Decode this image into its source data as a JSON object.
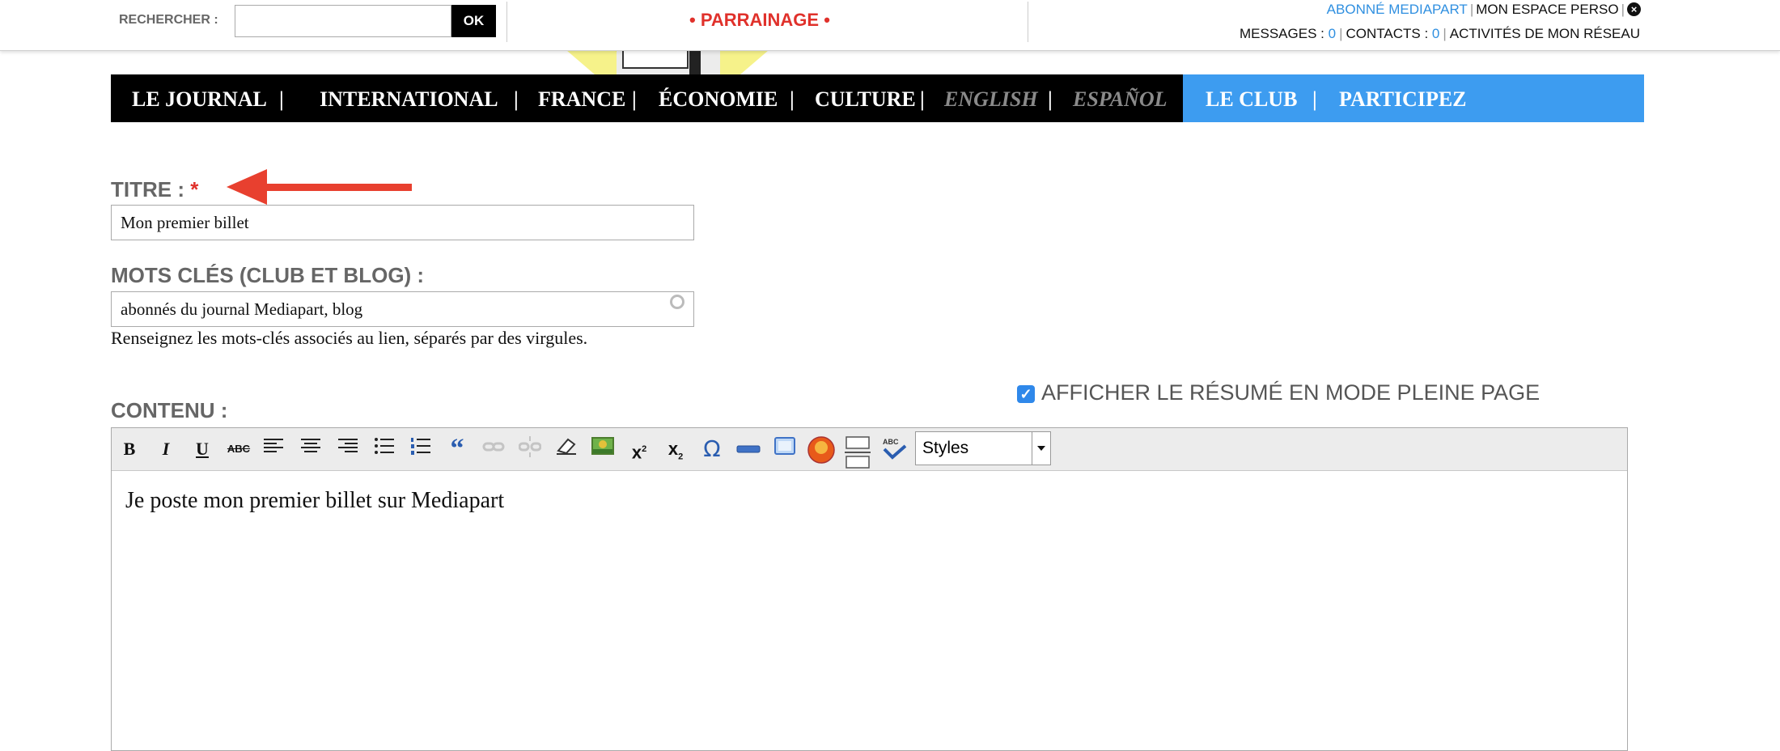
{
  "topbar": {
    "search_label": "RECHERCHER :",
    "search_value": "",
    "search_button": "OK",
    "parrainage": "• PARRAINAGE •",
    "subscriber": "ABONNÉ MEDIAPART",
    "espace_perso": "MON ESPACE PERSO",
    "messages_label": "MESSAGES : ",
    "messages_count": "0",
    "contacts_label": "CONTACTS : ",
    "contacts_count": "0",
    "activites": "ACTIVITÉS DE MON RÉSEAU"
  },
  "nav": {
    "items": [
      "LE JOURNAL",
      "INTERNATIONAL",
      "FRANCE",
      "ÉCONOMIE",
      "CULTURE",
      "ENGLISH",
      "ESPAÑOL",
      "LE CLUB",
      "PARTICIPEZ"
    ],
    "separator": "|"
  },
  "form": {
    "title_label": "TITRE :",
    "required_mark": "*",
    "title_value": "Mon premier billet",
    "keywords_label": "MOTS CLÉS (CLUB ET BLOG) :",
    "keywords_value": "abonnés du journal Mediapart, blog",
    "keywords_help": "Renseignez les mots-clés associés au lien, séparés par des virgules.",
    "summary_checkbox_label": "AFFICHER LE RÉSUMÉ EN MODE PLEINE PAGE",
    "summary_checked": true,
    "content_label": "CONTENU :",
    "styles_value": "Styles",
    "editor_text": "Je poste mon premier billet sur Mediapart"
  },
  "colors": {
    "accent_blue": "#3d9cf0",
    "nav_black": "#000000",
    "annotation_red": "#e8402f",
    "label_gray": "#666666"
  },
  "toolbar_icons": [
    "bold-icon",
    "italic-icon",
    "underline-icon",
    "strikethrough-icon",
    "align-left-icon",
    "align-center-icon",
    "align-right-icon",
    "bullet-list-icon",
    "numbered-list-icon",
    "blockquote-icon",
    "link-icon",
    "unlink-icon",
    "eraser-icon",
    "image-icon",
    "superscript-icon",
    "subscript-icon",
    "omega-icon",
    "horizontal-rule-icon",
    "embed-icon",
    "media-icon",
    "page-break-icon",
    "spellcheck-icon"
  ]
}
